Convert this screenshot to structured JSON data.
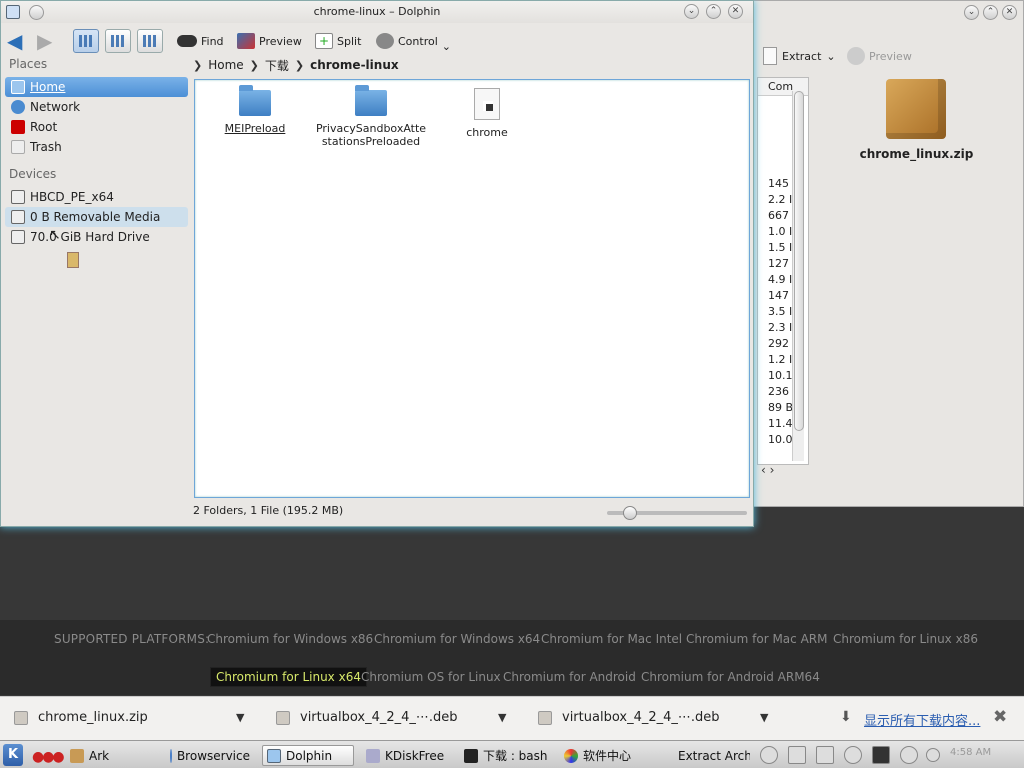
{
  "dolphin": {
    "title": "chrome-linux – Dolphin",
    "toolbar": {
      "find": "Find",
      "preview": "Preview",
      "split": "Split",
      "control": "Control"
    },
    "places_header": "Places",
    "places": [
      "Home",
      "Network",
      "Root",
      "Trash"
    ],
    "devices_header": "Devices",
    "devices": [
      "HBCD_PE_x64",
      "0 B Removable Media",
      "70.0 GiB Hard Drive"
    ],
    "breadcrumb": [
      "Home",
      "下载",
      "chrome-linux"
    ],
    "files": [
      {
        "name": "MEIPreload",
        "type": "folder"
      },
      {
        "name": "PrivacySandboxAttestationsPreloaded",
        "line1": "PrivacySandboxAtte",
        "line2": "stationsPreloaded",
        "type": "folder"
      },
      {
        "name": "chrome",
        "type": "file"
      }
    ],
    "status": "2 Folders, 1 File (195.2 MB)"
  },
  "ark": {
    "extract": "Extract",
    "preview": "Preview",
    "archive_name": "chrome_linux.zip",
    "col_header": "Com",
    "sizes": [
      "145",
      "2.2 I",
      "667",
      "1.0 I",
      "1.5 I",
      "127",
      "4.9 I",
      "147",
      "3.5 I",
      "2.3 I",
      "292",
      "1.2 I",
      "10.1",
      "236",
      "89 B",
      "11.4",
      "10.0"
    ]
  },
  "web": {
    "supported_label": "SUPPORTED PLATFORMS:",
    "platforms_row1": [
      "Chromium for Windows x86",
      "Chromium for Windows x64",
      "Chromium for Mac Intel",
      "Chromium for Mac ARM",
      "Chromium for Linux x86"
    ],
    "platforms_row2": [
      "Chromium for Linux x64",
      "Chromium OS for Linux",
      "Chromium for Android",
      "Chromium for Android ARM64"
    ],
    "active_platform": "Chromium for Linux x64"
  },
  "downloads": {
    "items": [
      "chrome_linux.zip",
      "virtualbox_4_2_4_⋯.deb",
      "virtualbox_4_2_4_⋯.deb"
    ],
    "show_all": "显示所有下载内容..."
  },
  "taskbar": {
    "tasks": [
      "Ark",
      "Browservice",
      "Dolphin",
      "KDiskFree",
      "下载 : bash",
      "软件中心",
      "Extract Arch"
    ],
    "active": "Dolphin",
    "clock": "4:58 AM"
  }
}
